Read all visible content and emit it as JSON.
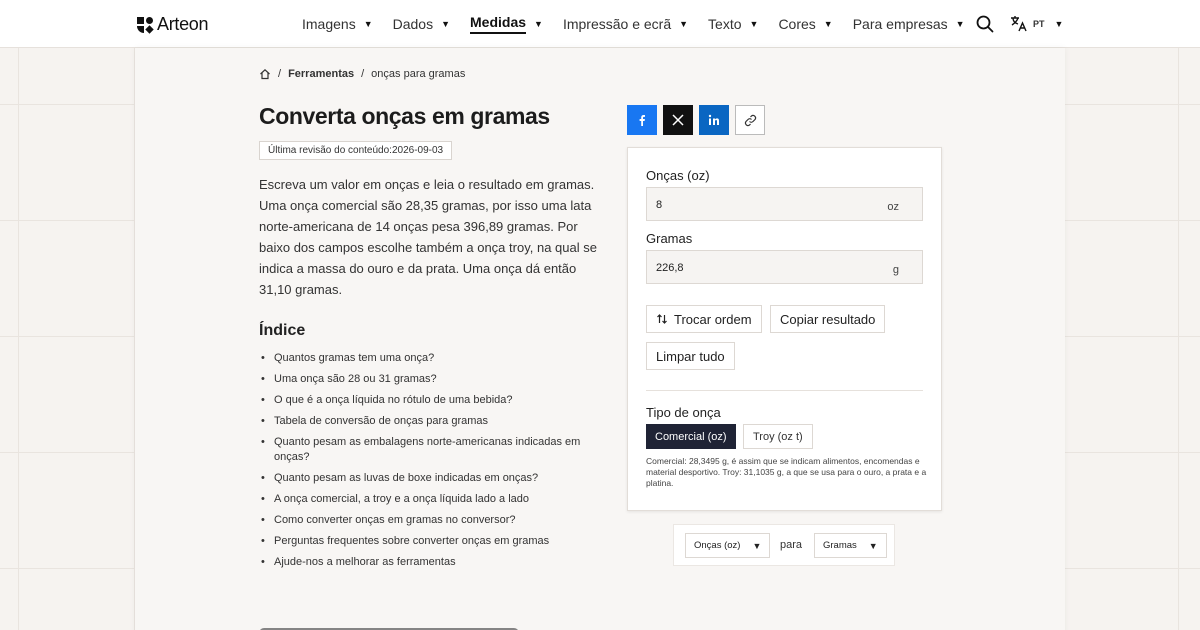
{
  "brand": {
    "name": "Arteon"
  },
  "nav": {
    "items": [
      {
        "label": "Imagens",
        "active": false
      },
      {
        "label": "Dados",
        "active": false
      },
      {
        "label": "Medidas",
        "active": true
      },
      {
        "label": "Impressão e ecrã",
        "active": false
      },
      {
        "label": "Texto",
        "active": false
      },
      {
        "label": "Cores",
        "active": false
      },
      {
        "label": "Para empresas",
        "active": false
      }
    ],
    "caret": "▼"
  },
  "language": {
    "code": "PT"
  },
  "breadcrumb": {
    "sep": "/",
    "section": "Ferramentas",
    "current": "onças para gramas"
  },
  "page": {
    "title": "Converta onças em gramas",
    "revision": "Última revisão do conteúdo:2026-09-03",
    "intro": "Escreva um valor em onças e leia o resultado em gramas. Uma onça comercial são 28,35 gramas, por isso uma lata norte-americana de 14 onças pesa 396,89 gramas. Por baixo dos campos escolhe também a onça troy, na qual se indica a massa do ouro e da prata. Uma onça dá então 31,10 gramas."
  },
  "toc": {
    "title": "Índice",
    "items": [
      "Quantos gramas tem uma onça?",
      "Uma onça são 28 ou 31 gramas?",
      "O que é a onça líquida no rótulo de uma bebida?",
      "Tabela de conversão de onças para gramas",
      "Quanto pesam as embalagens norte-americanas indicadas em onças?",
      "Quanto pesam as luvas de boxe indicadas em onças?",
      "A onça comercial, a troy e a onça líquida lado a lado",
      "Como converter onças em gramas no conversor?",
      "Perguntas frequentes sobre converter onças em gramas",
      "Ajude-nos a melhorar as ferramentas"
    ]
  },
  "share": {
    "icons": [
      "facebook-icon",
      "x-icon",
      "linkedin-icon",
      "link-icon"
    ]
  },
  "converter": {
    "from": {
      "label": "Onças (oz)",
      "value": "8",
      "unit": "oz"
    },
    "to": {
      "label": "Gramas",
      "value": "226,8",
      "unit": "g"
    },
    "swap_label": "Trocar ordem",
    "copy_label": "Copiar resultado",
    "clear_label": "Limpar tudo",
    "type_label": "Tipo de onça",
    "type_options": [
      {
        "label": "Comercial (oz)",
        "selected": true
      },
      {
        "label": "Troy (oz t)",
        "selected": false
      }
    ],
    "note": "Comercial: 28,3495 g, é assim que se indicam alimentos, encomendas e material desportivo. Troy: 31,1035 g, a que se usa para o ouro, a prata e a platina."
  },
  "unit_selector": {
    "from": "Onças (oz)",
    "connector": "para",
    "to": "Gramas"
  },
  "colors": {
    "accent_dark": "#1f2335",
    "facebook": "#1877f2",
    "linkedin": "#0a66c2",
    "x": "#111111"
  }
}
